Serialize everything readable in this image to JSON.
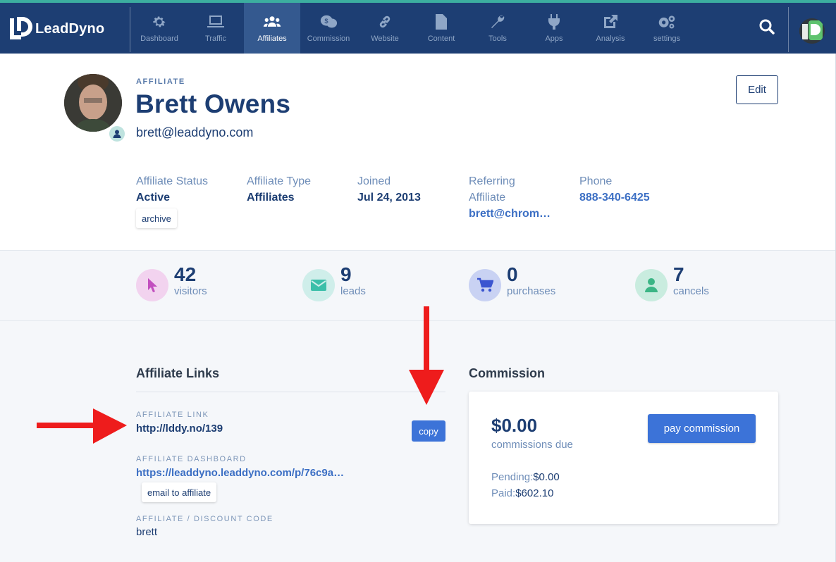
{
  "brand": {
    "name": "LeadDyno"
  },
  "nav": {
    "items": [
      {
        "label": "Dashboard",
        "icon": "gear-icon"
      },
      {
        "label": "Traffic",
        "icon": "laptop-icon"
      },
      {
        "label": "Affiliates",
        "icon": "users-icon",
        "active": true
      },
      {
        "label": "Commission",
        "icon": "coins-icon"
      },
      {
        "label": "Website",
        "icon": "link-icon"
      },
      {
        "label": "Content",
        "icon": "file-icon"
      },
      {
        "label": "Tools",
        "icon": "wrench-icon"
      },
      {
        "label": "Apps",
        "icon": "plug-icon"
      },
      {
        "label": "Analysis",
        "icon": "external-link-icon"
      },
      {
        "label": "settings",
        "icon": "gears-icon"
      }
    ]
  },
  "profile": {
    "eyebrow": "AFFILIATE",
    "name": "Brett Owens",
    "email": "brett@leaddyno.com",
    "edit_label": "Edit"
  },
  "meta": {
    "status": {
      "label": "Affiliate Status",
      "value": "Active"
    },
    "type": {
      "label": "Affiliate Type",
      "value": "Affiliates"
    },
    "joined": {
      "label": "Joined",
      "value": "Jul 24, 2013"
    },
    "referring": {
      "label_line1": "Referring",
      "label_line2": "Affiliate",
      "value": "brett@chrom…"
    },
    "phone": {
      "label": "Phone",
      "value": "888-340-6425"
    },
    "archive_label": "archive"
  },
  "stats": [
    {
      "value": "42",
      "caption": "visitors",
      "icon": "cursor-icon",
      "color": "#f2d3ef",
      "icon_color": "#c24fbf"
    },
    {
      "value": "9",
      "caption": "leads",
      "icon": "envelope-icon",
      "color": "#cfeeea",
      "icon_color": "#3bbfa9"
    },
    {
      "value": "0",
      "caption": "purchases",
      "icon": "cart-icon",
      "color": "#c9d2f3",
      "icon_color": "#3b55d0"
    },
    {
      "value": "7",
      "caption": "cancels",
      "icon": "person-icon",
      "color": "#c9ecdf",
      "icon_color": "#3bb585"
    }
  ],
  "links": {
    "title": "Affiliate Links",
    "affiliate_link_label": "AFFILIATE LINK",
    "affiliate_link": "http://lddy.no/139",
    "copy_label": "copy",
    "dashboard_label": "AFFILIATE DASHBOARD",
    "dashboard_link": "https://leaddyno.leaddyno.com/p/76c9a…",
    "email_label": "email to affiliate",
    "code_label": "AFFILIATE / DISCOUNT CODE",
    "code": "brett"
  },
  "commission": {
    "title": "Commission",
    "amount": "$0.00",
    "due_label": "commissions due",
    "pay_label": "pay commission",
    "pending_label": "Pending:",
    "pending_value": "$0.00",
    "paid_label": "Paid:",
    "paid_value": "$602.10"
  },
  "colors": {
    "navbar": "#1d3e73",
    "accent_stripe": "#3cae9f",
    "primary_button": "#3c73d8",
    "annotation_arrow": "#ee1c1c"
  }
}
